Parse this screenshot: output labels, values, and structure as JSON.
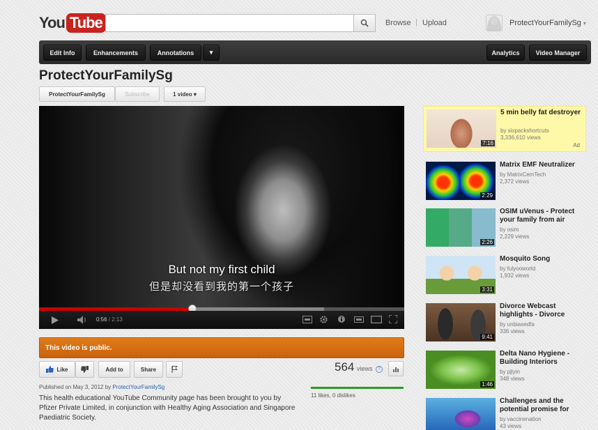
{
  "masthead": {
    "logo_you": "You",
    "logo_tube": "Tube",
    "search_value": "",
    "browse": "Browse",
    "upload": "Upload",
    "separator": "|",
    "user_name": "ProtectYourFamilySg",
    "user_caret": "▾"
  },
  "toolbar": {
    "edit_info": "Edit Info",
    "enhancements": "Enhancements",
    "annotations": "Annotations",
    "more": "▾",
    "analytics": "Analytics",
    "video_manager": "Video Manager"
  },
  "channel": {
    "title": "ProtectYourFamilySg",
    "name_button": "ProtectYourFamilySg",
    "subscribe": "Subscribe",
    "video_count": "1 video ▾"
  },
  "player": {
    "caption_en": "But not my first child",
    "caption_zh": "但是却没看到我的第一个孩子",
    "time_current": "0:56",
    "time_duration": "/ 2:13",
    "progress_played_fraction": 0.42,
    "progress_buffered_fraction": 0.78
  },
  "status": {
    "public_banner": "This video is public."
  },
  "actions": {
    "like": "Like",
    "add_to": "Add to",
    "share": "Share",
    "views_count": "564",
    "views_label": "views",
    "help": "?"
  },
  "info": {
    "published_prefix": "Published on May 3, 2012 by ",
    "published_by": "ProtectYourFamilySg",
    "description": "This health educational YouTube Community page has been brought to you by Pfizer Private Limited, in conjunction with Healthy Aging Association and Singapore Paediatric Society.",
    "likes_text": "11 likes, 0 dislikes"
  },
  "sidebar": {
    "items": [
      {
        "title": "5 min belly fat destroyer",
        "by": "by sixpackshortcuts",
        "views": "3,336,610 views",
        "duration": "7:16",
        "ad_label": "Ad"
      },
      {
        "title": "Matrix EMF Neutralizer",
        "by": "by MatrixCemTech",
        "views": "2,372 views",
        "duration": "2:29"
      },
      {
        "title": "OSIM uVenus - Protect your family from air",
        "by": "by osim",
        "views": "2,229 views",
        "duration": "2:26"
      },
      {
        "title": "Mosquito Song",
        "by": "by fulyooworld",
        "views": "1,932 views",
        "duration": "3:31"
      },
      {
        "title": "Divorce Webcast highlights - Divorce",
        "by": "by unbiasedfa",
        "views": "336 views",
        "duration": "9:41"
      },
      {
        "title": "Delta Nano Hygiene - Building Interiors",
        "by": "by pjlyin",
        "views": "348 views",
        "duration": "1:46"
      },
      {
        "title": "Challenges and the potential promise for",
        "by": "by vaccinenation",
        "views": "43 views",
        "duration": ""
      }
    ]
  },
  "colors": {
    "brand_red": "#c8231f",
    "public_orange": "#d96f12",
    "ad_yellow": "#fef9a8",
    "progress_red": "#cc0000",
    "like_green": "#2a9a2a",
    "link_blue": "#2860b0"
  }
}
